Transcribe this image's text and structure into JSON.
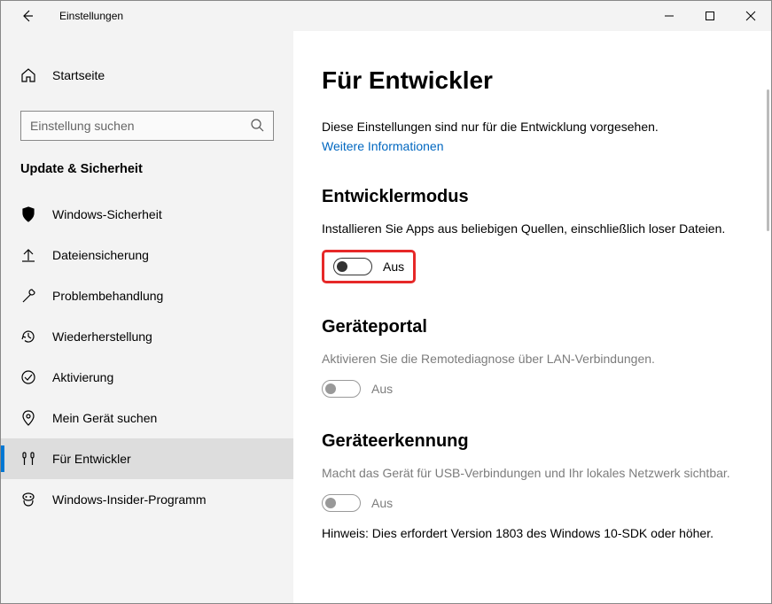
{
  "titlebar": {
    "title": "Einstellungen"
  },
  "sidebar": {
    "home": "Startseite",
    "search_placeholder": "Einstellung suchen",
    "section": "Update & Sicherheit",
    "items": [
      {
        "label": "Windows-Sicherheit"
      },
      {
        "label": "Dateiensicherung"
      },
      {
        "label": "Problembehandlung"
      },
      {
        "label": "Wiederherstellung"
      },
      {
        "label": "Aktivierung"
      },
      {
        "label": "Mein Gerät suchen"
      },
      {
        "label": "Für Entwickler"
      },
      {
        "label": "Windows-Insider-Programm"
      }
    ]
  },
  "content": {
    "heading": "Für Entwickler",
    "intro": "Diese Einstellungen sind nur für die Entwicklung vorgesehen.",
    "learn_more": "Weitere Informationen",
    "dev_mode": {
      "title": "Entwicklermodus",
      "desc": "Installieren Sie Apps aus beliebigen Quellen, einschließlich loser Dateien.",
      "state": "Aus"
    },
    "device_portal": {
      "title": "Geräteportal",
      "desc": "Aktivieren Sie die Remotediagnose über LAN-Verbindungen.",
      "state": "Aus"
    },
    "device_discovery": {
      "title": "Geräteerkennung",
      "desc": "Macht das Gerät für USB-Verbindungen und Ihr lokales Netzwerk sichtbar.",
      "state": "Aus",
      "hint": "Hinweis: Dies erfordert Version 1803 des Windows 10-SDK oder höher."
    }
  }
}
